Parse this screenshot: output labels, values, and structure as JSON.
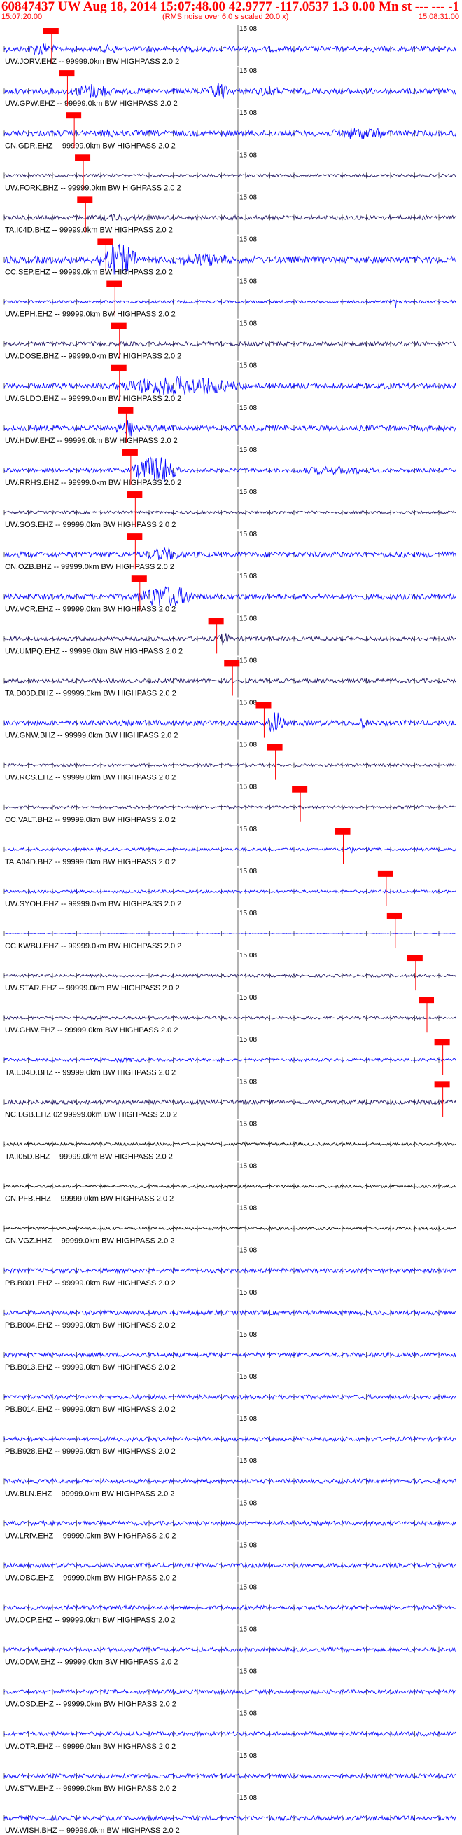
{
  "header": {
    "title": "60847437 UW Aug 18, 2014 15:07:48.00 42.9777 -117.0537 1.3 0.00 Mn st --- --- -1",
    "start_time": "15:07:20.00",
    "rms_note": "(RMS noise over 6.0 s scaled 20.0 x)",
    "end_time": "15:08:31.00"
  },
  "time_label": "15:08",
  "pick_color": "#ff0000",
  "traces": [
    {
      "label": "UW.JORV.EHZ -- 99999.0km BW HIGHPASS 2.0 2",
      "color": "#0000ff",
      "pick": 0.105,
      "amp": 4,
      "bursts": [
        [
          0.04,
          0.16,
          2.5
        ],
        [
          0.2,
          0.3,
          1.6
        ]
      ]
    },
    {
      "label": "UW.GPW.EHZ -- 99999.0km BW HIGHPASS 2.0 2",
      "color": "#0000ff",
      "pick": 0.14,
      "amp": 4,
      "bursts": [
        [
          0.14,
          0.3,
          2.8
        ],
        [
          0.45,
          0.52,
          3.5
        ],
        [
          0.55,
          0.65,
          2
        ]
      ]
    },
    {
      "label": "CN.GDR.EHZ -- 99999.0km BW HIGHPASS 2.0 2",
      "color": "#0000ff",
      "pick": 0.155,
      "amp": 4,
      "bursts": [
        [
          0.7,
          0.95,
          2.2
        ],
        [
          0.2,
          0.3,
          1.6
        ]
      ]
    },
    {
      "label": "UW.FORK.BHZ -- 99999.0km BW HIGHPASS 2.0 2",
      "color": "#1a1060",
      "pick": 0.175,
      "amp": 2,
      "bursts": []
    },
    {
      "label": "TA.I04D.BHZ -- 99999.0km BW HIGHPASS 2.0 2",
      "color": "#1a1060",
      "pick": 0.18,
      "amp": 3,
      "bursts": [
        [
          0.15,
          0.45,
          1.6
        ]
      ]
    },
    {
      "label": "CC.SEP.EHZ -- 99999.0km BW HIGHPASS 2.0 2",
      "color": "#0000ff",
      "pick": 0.225,
      "amp": 5,
      "bursts": [
        [
          0.2,
          0.35,
          4.5
        ],
        [
          0.35,
          0.6,
          2
        ]
      ]
    },
    {
      "label": "UW.EPH.EHZ -- 99999.0km BW HIGHPASS 2.0 2",
      "color": "#0000ff",
      "pick": 0.245,
      "amp": 2,
      "bursts": [
        [
          0.86,
          0.87,
          8
        ]
      ]
    },
    {
      "label": "UW.DOSE.BHZ -- 99999.0km BW HIGHPASS 2.0 2",
      "color": "#1a1060",
      "pick": 0.255,
      "amp": 3,
      "bursts": []
    },
    {
      "label": "UW.GLDO.EHZ -- 99999.0km BW HIGHPASS 2.0 2",
      "color": "#0000ff",
      "pick": 0.255,
      "amp": 4,
      "bursts": [
        [
          0.22,
          0.7,
          3.5
        ]
      ]
    },
    {
      "label": "UW.HDW.EHZ -- 99999.0km BW HIGHPASS 2.0 2",
      "color": "#0000ff",
      "pick": 0.27,
      "amp": 4,
      "bursts": [
        [
          0.24,
          0.34,
          3.2
        ]
      ]
    },
    {
      "label": "UW.RRHS.EHZ -- 99999.0km BW HIGHPASS 2.0 2",
      "color": "#0000ff",
      "pick": 0.28,
      "amp": 3,
      "bursts": [
        [
          0.28,
          0.44,
          7
        ],
        [
          0.6,
          0.98,
          2
        ]
      ]
    },
    {
      "label": "UW.SOS.EHZ -- 99999.0km BW HIGHPASS 2.0 2",
      "color": "#1a1060",
      "pick": 0.29,
      "amp": 2,
      "bursts": []
    },
    {
      "label": "CN.OZB.BHZ -- 99999.0km BW HIGHPASS 2.0 2",
      "color": "#0000ff",
      "pick": 0.29,
      "amp": 4,
      "bursts": [
        [
          0.3,
          0.45,
          2.5
        ]
      ]
    },
    {
      "label": "UW.VCR.EHZ -- 99999.0km BW HIGHPASS 2.0 2",
      "color": "#0000ff",
      "pick": 0.3,
      "amp": 4,
      "bursts": [
        [
          0.28,
          0.5,
          4
        ]
      ]
    },
    {
      "label": "UW.UMPQ.EHZ -- 99999.0km BW HIGHPASS 2.0 2",
      "color": "#1a1060",
      "pick": 0.47,
      "amp": 3,
      "bursts": [
        [
          0.47,
          0.52,
          3
        ]
      ]
    },
    {
      "label": "TA.D03D.BHZ -- 99999.0km BW HIGHPASS 2.0 2",
      "color": "#1a1060",
      "pick": 0.505,
      "amp": 3,
      "bursts": []
    },
    {
      "label": "UW.GNW.BHZ -- 99999.0km BW HIGHPASS 2.0 2",
      "color": "#0000ff",
      "pick": 0.575,
      "amp": 4,
      "bursts": [
        [
          0.58,
          0.64,
          4.5
        ],
        [
          0.78,
          0.82,
          2.5
        ]
      ]
    },
    {
      "label": "UW.RCS.EHZ -- 99999.0km BW HIGHPASS 2.0 2",
      "color": "#1a1060",
      "pick": 0.6,
      "amp": 2,
      "bursts": []
    },
    {
      "label": "CC.VALT.BHZ -- 99999.0km BW HIGHPASS 2.0 2",
      "color": "#1a1060",
      "pick": 0.655,
      "amp": 2,
      "bursts": []
    },
    {
      "label": "TA.A04D.BHZ -- 99999.0km BW HIGHPASS 2.0 2",
      "color": "#0000ff",
      "pick": 0.75,
      "amp": 2,
      "bursts": [
        [
          0.76,
          0.78,
          4
        ]
      ]
    },
    {
      "label": "UW.SYOH.EHZ -- 99999.0km BW HIGHPASS 2.0 2",
      "color": "#0000ff",
      "pick": 0.845,
      "amp": 2,
      "bursts": []
    },
    {
      "label": "CC.KWBU.EHZ -- 99999.0km BW HIGHPASS 2.0 2",
      "color": "#0000ff",
      "pick": 0.865,
      "amp": 0.4,
      "bursts": []
    },
    {
      "label": "UW.STAR.EHZ -- 99999.0km BW HIGHPASS 2.0 2",
      "color": "#1a1060",
      "pick": 0.91,
      "amp": 2,
      "bursts": []
    },
    {
      "label": "UW.GHW.EHZ -- 99999.0km BW HIGHPASS 2.0 2",
      "color": "#1a1060",
      "pick": 0.935,
      "amp": 2,
      "bursts": []
    },
    {
      "label": "TA.E04D.BHZ -- 99999.0km BW HIGHPASS 2.0 2",
      "color": "#0000ff",
      "pick": 0.97,
      "amp": 2,
      "bursts": [
        [
          0.2,
          0.4,
          1.6
        ]
      ]
    },
    {
      "label": "NC.LGB.EHZ.02 99999.0km BW HIGHPASS 2.0 2",
      "color": "#1a1060",
      "pick": 0.97,
      "amp": 3,
      "bursts": []
    },
    {
      "label": "TA.I05D.BHZ -- 99999.0km BW HIGHPASS 2.0 2",
      "color": "#000000",
      "amp": 2,
      "bursts": []
    },
    {
      "label": "CN.PFB.HHZ -- 99999.0km BW HIGHPASS 2.0 2",
      "color": "#000000",
      "amp": 2,
      "bursts": []
    },
    {
      "label": "CN.VGZ.HHZ -- 99999.0km BW HIGHPASS 2.0 2",
      "color": "#000000",
      "amp": 2,
      "bursts": []
    },
    {
      "label": "PB.B001.EHZ -- 99999.0km BW HIGHPASS 2.0 2",
      "color": "#0000ff",
      "amp": 3,
      "bursts": []
    },
    {
      "label": "PB.B004.EHZ -- 99999.0km BW HIGHPASS 2.0 2",
      "color": "#0000ff",
      "amp": 3,
      "bursts": []
    },
    {
      "label": "PB.B013.EHZ -- 99999.0km BW HIGHPASS 2.0 2",
      "color": "#0000ff",
      "amp": 3,
      "bursts": []
    },
    {
      "label": "PB.B014.EHZ -- 99999.0km BW HIGHPASS 2.0 2",
      "color": "#0000ff",
      "amp": 3,
      "bursts": []
    },
    {
      "label": "PB.B928.EHZ -- 99999.0km BW HIGHPASS 2.0 2",
      "color": "#0000ff",
      "amp": 3,
      "bursts": []
    },
    {
      "label": "UW.BLN.EHZ -- 99999.0km BW HIGHPASS 2.0 2",
      "color": "#0000ff",
      "amp": 3,
      "bursts": []
    },
    {
      "label": "UW.LRIV.EHZ -- 99999.0km BW HIGHPASS 2.0 2",
      "color": "#0000ff",
      "amp": 3,
      "bursts": []
    },
    {
      "label": "UW.OBC.EHZ -- 99999.0km BW HIGHPASS 2.0 2",
      "color": "#0000ff",
      "amp": 3,
      "bursts": []
    },
    {
      "label": "UW.OCP.EHZ -- 99999.0km BW HIGHPASS 2.0 2",
      "color": "#0000ff",
      "amp": 3,
      "bursts": []
    },
    {
      "label": "UW.ODW.EHZ -- 99999.0km BW HIGHPASS 2.0 2",
      "color": "#0000ff",
      "amp": 3,
      "bursts": []
    },
    {
      "label": "UW.OSD.EHZ -- 99999.0km BW HIGHPASS 2.0 2",
      "color": "#0000ff",
      "amp": 3,
      "bursts": []
    },
    {
      "label": "UW.OTR.EHZ -- 99999.0km BW HIGHPASS 2.0 2",
      "color": "#0000ff",
      "amp": 3,
      "bursts": []
    },
    {
      "label": "UW.STW.EHZ -- 99999.0km BW HIGHPASS 2.0 2",
      "color": "#0000ff",
      "amp": 3,
      "bursts": []
    },
    {
      "label": "UW.WISH.BHZ -- 99999.0km BW HIGHPASS 2.0 2",
      "color": "#0000ff",
      "amp": 3,
      "bursts": []
    }
  ]
}
